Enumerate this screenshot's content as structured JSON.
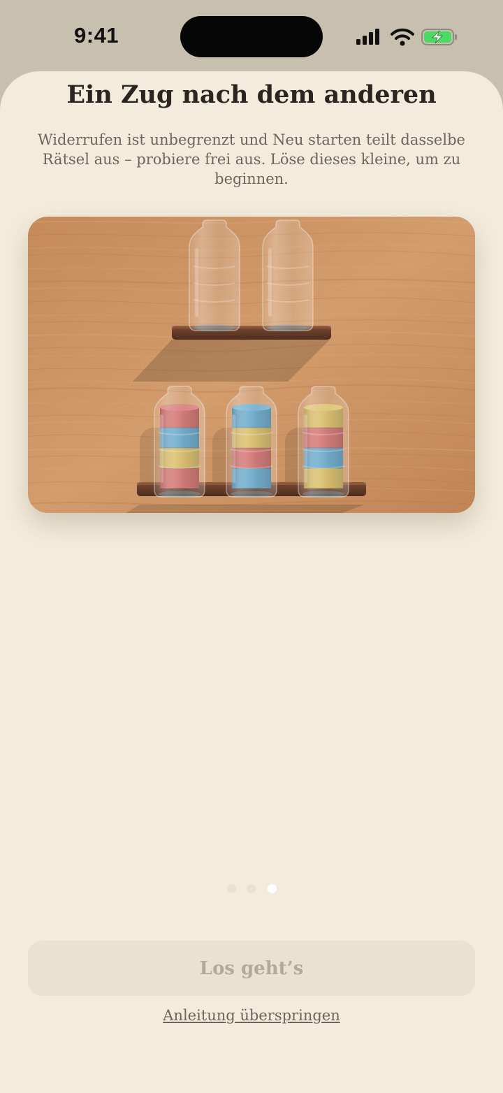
{
  "status": {
    "time": "9:41",
    "icons": [
      "signal-icon",
      "wifi-icon",
      "battery-charging-icon"
    ],
    "battery_color": "#4cd964"
  },
  "onboarding": {
    "title": "Ein Zug nach dem anderen",
    "subtitle": "Widerrufen ist unbegrenzt und Neu starten teilt dasselbe Rätsel aus – probiere frei aus. Löse dieses kleine, um zu beginnen.",
    "page_count": 3,
    "current_page": 3,
    "cta_label": "Los geht’s",
    "skip_label": "Anleitung überspringen"
  },
  "puzzle": {
    "colors": {
      "red": "#cf5a56",
      "yellow": "#d7b44c",
      "blue": "#4f9cc4"
    },
    "top_shelf_bottles": [
      [],
      []
    ],
    "bottom_shelf_bottles": [
      [
        "red",
        "yellow",
        "blue",
        "red"
      ],
      [
        "blue",
        "red",
        "yellow",
        "blue"
      ],
      [
        "yellow",
        "blue",
        "red",
        "yellow"
      ]
    ]
  }
}
